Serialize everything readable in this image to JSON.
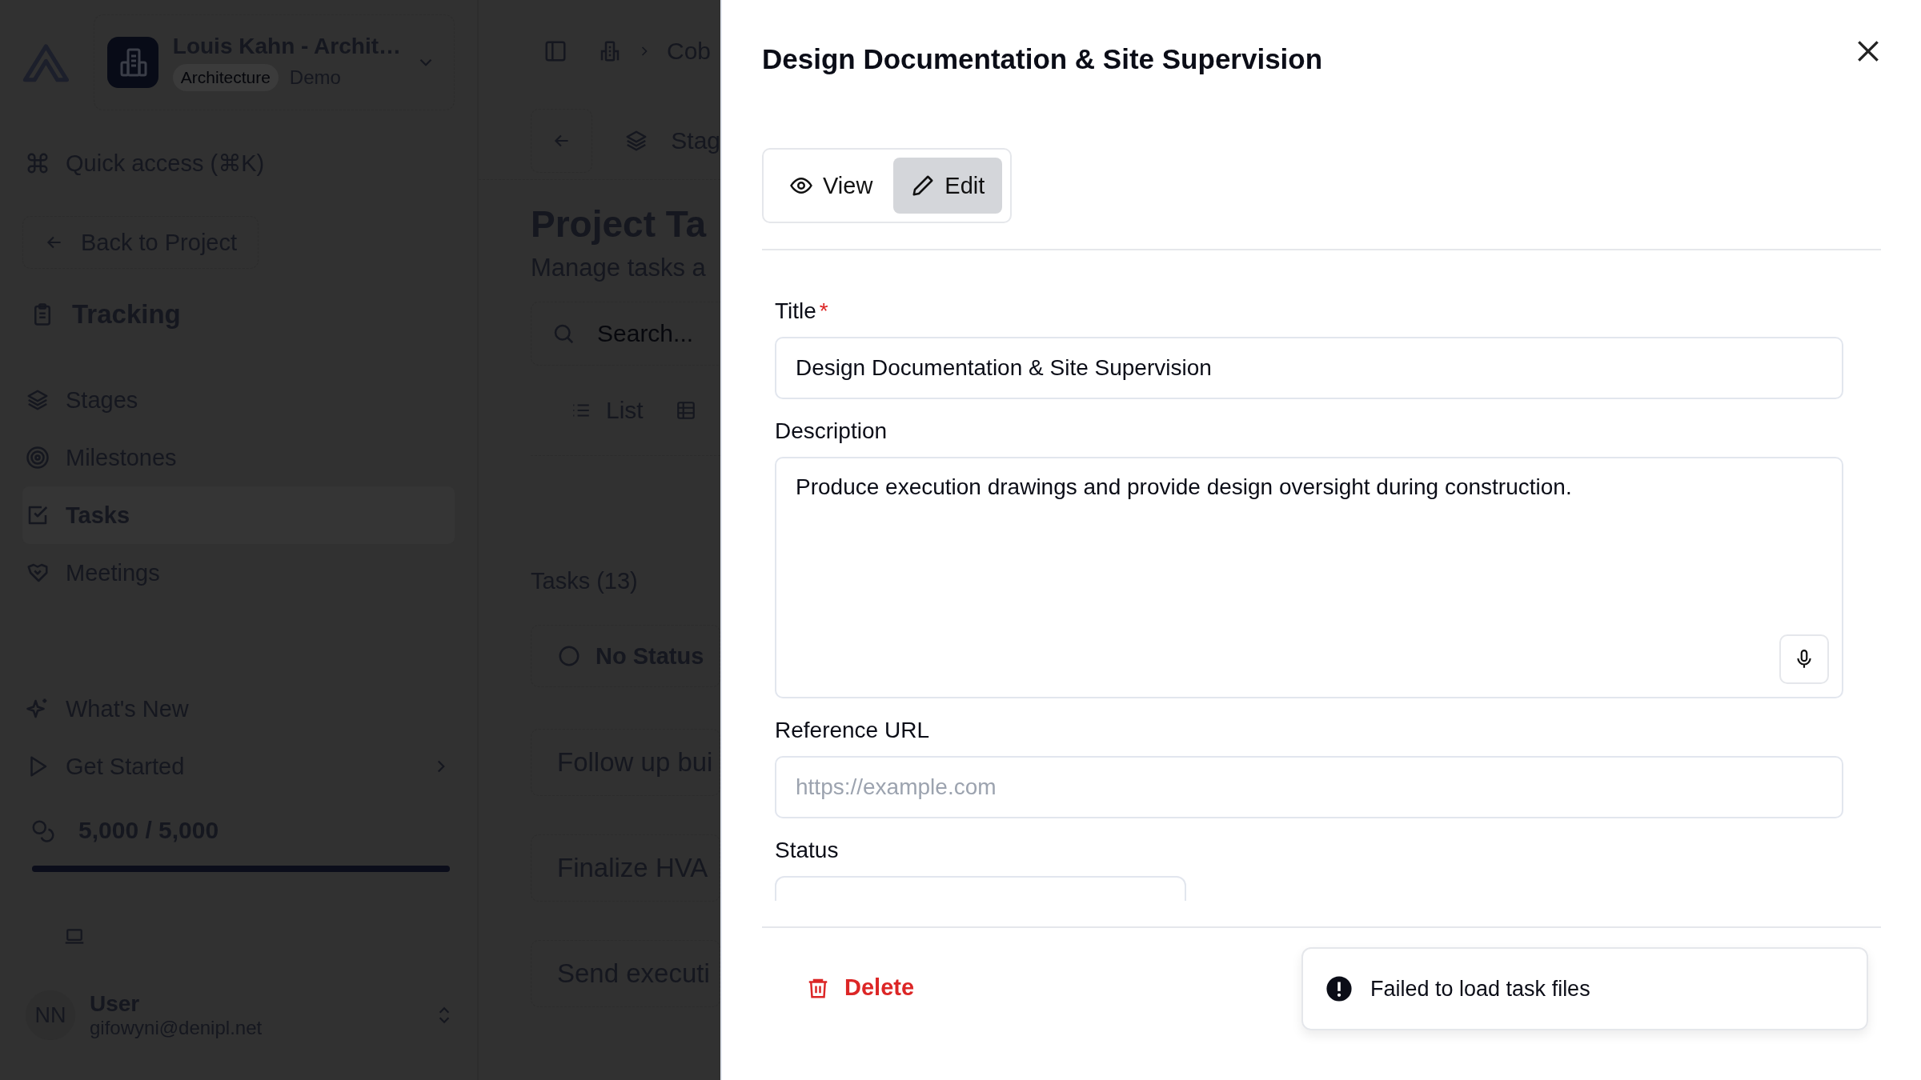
{
  "sidebar": {
    "project": {
      "name": "Louis Kahn - Archit…",
      "tag": "Architecture",
      "label": "Demo"
    },
    "quick_access": "Quick access (⌘K)",
    "back_button": "Back to Project",
    "section": "Tracking",
    "nav_items": [
      {
        "label": "Stages",
        "selected": false
      },
      {
        "label": "Milestones",
        "selected": false
      },
      {
        "label": "Tasks",
        "selected": true
      },
      {
        "label": "Meetings",
        "selected": false
      }
    ],
    "footer_items": [
      {
        "label": "What's New"
      },
      {
        "label": "Get Started"
      }
    ],
    "credits": {
      "text": "5,000 / 5,000",
      "level": 1
    },
    "user": {
      "initials": "NN",
      "name": "User",
      "email": "gifowyni@denipl.net"
    }
  },
  "main": {
    "breadcrumb": "Cob",
    "stage_tab": "Stag",
    "title": "Project Ta",
    "subtitle": "Manage tasks a",
    "search": {
      "placeholder": "Search..."
    },
    "view_tab": "List",
    "tasks_heading": "Tasks (13)",
    "group": "No Status",
    "tasks": [
      "Follow up bui",
      "Finalize HVA",
      "Send executi"
    ]
  },
  "panel": {
    "title": "Design Documentation & Site Supervision",
    "modes": [
      {
        "label": "View",
        "selected": false
      },
      {
        "label": "Edit",
        "selected": true
      }
    ],
    "fields": [
      {
        "kind": "input",
        "label": "Title",
        "required_mark": "*",
        "value": "Design Documentation & Site Supervision"
      },
      {
        "kind": "textarea",
        "label": "Description",
        "value": "Produce execution drawings and provide design oversight during construction."
      },
      {
        "kind": "input",
        "label": "Reference URL",
        "placeholder": "https://example.com"
      },
      {
        "kind": "select",
        "label": "Status"
      }
    ],
    "delete_button": "Delete",
    "toast": {
      "message": "Failed to load task files"
    }
  }
}
